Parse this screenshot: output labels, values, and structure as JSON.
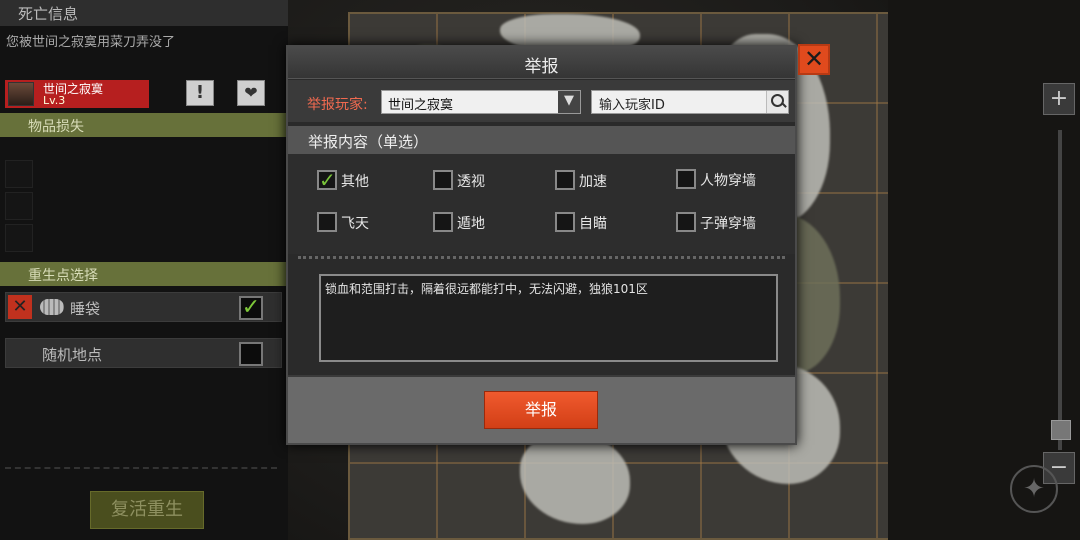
{
  "death": {
    "title": "死亡信息",
    "message": "您被世间之寂寞用菜刀弄没了",
    "killer_name": "世间之寂寞",
    "killer_level": "Lv.3"
  },
  "left_panel": {
    "items_lost_label": "物品损失",
    "respawn_select_label": "重生点选择",
    "spawn_options": [
      {
        "label": "睡袋",
        "checked": true
      },
      {
        "label": "随机地点",
        "checked": false
      }
    ],
    "respawn_button": "复活重生"
  },
  "report": {
    "title": "举报",
    "player_label": "举报玩家:",
    "player_selected": "世间之寂寞",
    "player_id_placeholder": "输入玩家ID",
    "content_label": "举报内容（单选）",
    "options": [
      {
        "label": "其他",
        "checked": true
      },
      {
        "label": "透视",
        "checked": false
      },
      {
        "label": "加速",
        "checked": false
      },
      {
        "label": "人物穿墙",
        "checked": false
      },
      {
        "label": "飞天",
        "checked": false
      },
      {
        "label": "遁地",
        "checked": false
      },
      {
        "label": "自瞄",
        "checked": false
      },
      {
        "label": "子弹穿墙",
        "checked": false
      }
    ],
    "reason_text": "锁血和范围打击，隔着很远都能打中，无法闪避，独狼101区",
    "submit_button": "举报"
  },
  "map": {
    "zoom_in": "+",
    "zoom_out": "−"
  },
  "colors": {
    "accent_red": "#e04a1d",
    "header_green": "#67713a",
    "checkmark_green": "#7ac43a"
  }
}
